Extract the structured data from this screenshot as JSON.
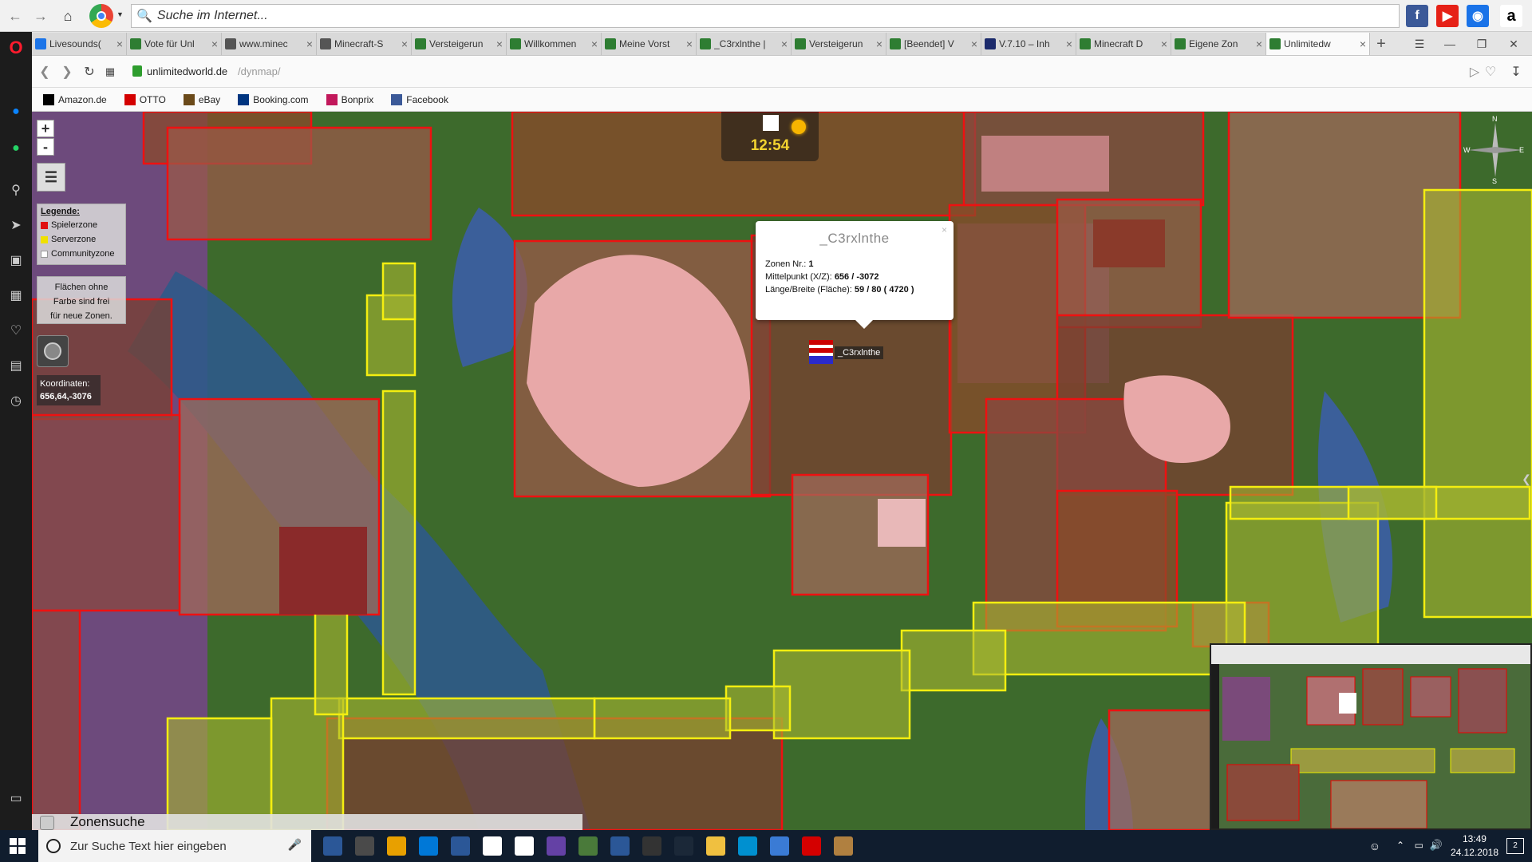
{
  "top": {
    "search_placeholder": "Suche im Internet..."
  },
  "tabs": [
    {
      "label": "Livesounds(",
      "color": "#1b74e8"
    },
    {
      "label": "Vote für Unl",
      "color": "#2e7d32"
    },
    {
      "label": "www.minec",
      "color": "#555555"
    },
    {
      "label": "Minecraft-S",
      "color": "#555555"
    },
    {
      "label": "Versteigerun",
      "color": "#2e7d32"
    },
    {
      "label": "Willkommen",
      "color": "#2e7d32"
    },
    {
      "label": "Meine Vorst",
      "color": "#2e7d32"
    },
    {
      "label": "_C3rxlnthe |",
      "color": "#2e7d32"
    },
    {
      "label": "Versteigerun",
      "color": "#2e7d32"
    },
    {
      "label": "[Beendet] V",
      "color": "#2e7d32"
    },
    {
      "label": "V.7.10 – Inh",
      "color": "#1b2a6b"
    },
    {
      "label": "Minecraft D",
      "color": "#2e7d32"
    },
    {
      "label": "Eigene Zon",
      "color": "#2e7d32"
    },
    {
      "label": "Unlimitedw",
      "color": "#2e7d32",
      "active": true
    }
  ],
  "address": {
    "host": "unlimitedworld.de",
    "path": "/dynmap/"
  },
  "bookmarks": [
    {
      "label": "Amazon.de",
      "icon": "amazon-icon",
      "color": "#000000"
    },
    {
      "label": "OTTO",
      "icon": "otto-icon",
      "color": "#d40000"
    },
    {
      "label": "eBay",
      "icon": "ebay-icon",
      "color": "#6b4a1a"
    },
    {
      "label": "Booking.com",
      "icon": "booking-icon",
      "color": "#003580"
    },
    {
      "label": "Bonprix",
      "icon": "bonprix-icon",
      "color": "#c2185b"
    },
    {
      "label": "Facebook",
      "icon": "facebook-icon",
      "color": "#3b5998"
    }
  ],
  "map": {
    "zoom_in": "+",
    "zoom_out": "-",
    "clock_time": "12:54",
    "legend": {
      "title": "Legende:",
      "items": [
        {
          "label": "Spielerzone",
          "color": "#e01010"
        },
        {
          "label": "Serverzone",
          "color": "#f0e000"
        },
        {
          "label": "Communityzone",
          "color": "#ffffff"
        }
      ]
    },
    "free_note": [
      "Flächen ohne",
      "Farbe sind frei",
      "für neue Zonen."
    ],
    "coords_label": "Koordinaten:",
    "coords_value": "656,64,-3076",
    "popup": {
      "title": "_C3rxlnthe",
      "zone_label": "Zonen Nr.:",
      "zone_value": "1",
      "center_label": "Mittelpunkt (X/Z):",
      "center_value": "656 / -3072",
      "size_label": "Länge/Breite (Fläche):",
      "size_value": "59 / 80 ( 4720 )",
      "close": "×"
    },
    "player_name": "_C3rxlnthe",
    "compass": {
      "n": "N",
      "e": "E",
      "w": "W",
      "s": "S"
    },
    "zone_search": "Zonensuche"
  },
  "taskbar": {
    "search_placeholder": "Zur Suche Text hier eingeben",
    "time": "13:49",
    "date": "24.12.2018",
    "notifications": "2"
  }
}
